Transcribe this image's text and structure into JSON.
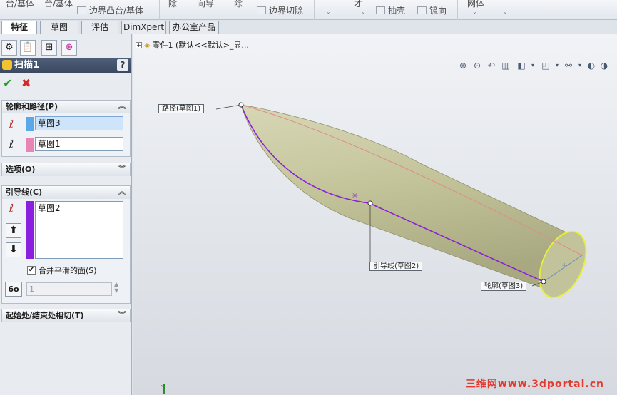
{
  "ribbon": {
    "items": [
      "台/基体",
      "台/基体",
      "边界凸台/基体",
      "除",
      "向导",
      "除",
      "边界切除",
      "抽壳",
      "镜向",
      "网体"
    ],
    "extra_text": "才"
  },
  "tabs": [
    "特征",
    "草图",
    "评估",
    "DimXpert",
    "办公室产品"
  ],
  "active_tab": "特征",
  "property_manager": {
    "title": "扫描1",
    "help_label": "?",
    "ok_icon": "check-icon",
    "cancel_icon": "x-icon",
    "profile_path": {
      "header": "轮廓和路径(P)",
      "profile_field": "草图3",
      "path_field": "草图1",
      "profile_color": "#5aa8e8",
      "path_color": "#e985b4"
    },
    "options": {
      "header": "选项(O)"
    },
    "guide_curves": {
      "header": "引导线(C)",
      "items": [
        "草图2"
      ],
      "color": "#8a1fe0",
      "merge_label": "合并平滑的面(S)",
      "merge_checked": true,
      "spin_value": "1"
    },
    "tangency": {
      "header": "起始处/结束处相切(T)"
    }
  },
  "viewport": {
    "tree_root_label": "零件1  (默认<<默认>_显...",
    "callouts": {
      "path": "路径(草图1)",
      "guide": "引导线(草图2)",
      "profile": "轮廓(草图3)"
    },
    "axis_label": "Y",
    "watermark": "三维网www.3dportal.cn"
  },
  "colors": {
    "body_fill": "#c9c9a2",
    "guide_line": "#8a22d6",
    "path_line": "#e08a8a",
    "profile_ring": "#e6f03a",
    "title_bar": "#445570"
  }
}
